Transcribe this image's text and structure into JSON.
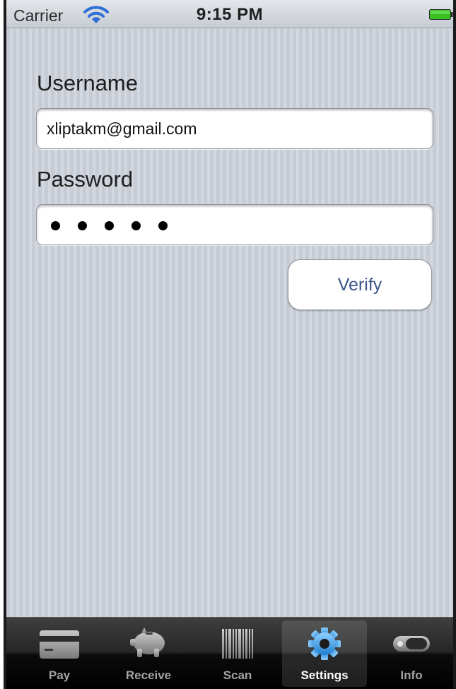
{
  "status_bar": {
    "carrier": "Carrier",
    "time": "9:15 PM"
  },
  "form": {
    "username_label": "Username",
    "username_value": "xliptakm@gmail.com",
    "password_label": "Password",
    "password_masked_length": 5,
    "verify_label": "Verify"
  },
  "tab_bar": {
    "selected": "Settings",
    "tabs": [
      {
        "label": "Pay",
        "icon": "credit-card-icon"
      },
      {
        "label": "Receive",
        "icon": "piggy-bank-icon"
      },
      {
        "label": "Scan",
        "icon": "barcode-icon"
      },
      {
        "label": "Settings",
        "icon": "gear-icon"
      },
      {
        "label": "Info",
        "icon": "toggle-icon"
      }
    ]
  },
  "colors": {
    "accent_blue": "#3b5687",
    "selected_icon": "#3fa0e6",
    "battery_green": "#39c221"
  }
}
